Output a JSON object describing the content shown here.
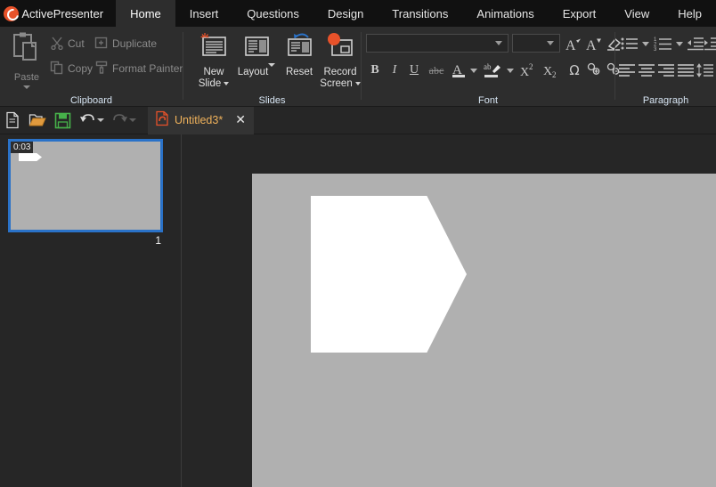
{
  "app": {
    "name": "ActivePresenter",
    "logo_icon": "activepresenter-logo-icon"
  },
  "tabs": [
    {
      "label": "Home",
      "active": true
    },
    {
      "label": "Insert",
      "active": false
    },
    {
      "label": "Questions",
      "active": false
    },
    {
      "label": "Design",
      "active": false
    },
    {
      "label": "Transitions",
      "active": false
    },
    {
      "label": "Animations",
      "active": false
    },
    {
      "label": "Export",
      "active": false
    },
    {
      "label": "View",
      "active": false
    },
    {
      "label": "Help",
      "active": false
    }
  ],
  "ribbon": {
    "clipboard": {
      "group_label": "Clipboard",
      "paste_label": "Paste",
      "paste_icon": "clipboard-icon",
      "items": [
        {
          "label": "Cut",
          "icon": "scissors-icon"
        },
        {
          "label": "Duplicate",
          "icon": "duplicate-icon"
        },
        {
          "label": "Copy",
          "icon": "copy-icon"
        },
        {
          "label": "Format Painter",
          "icon": "format-painter-icon"
        }
      ]
    },
    "slides": {
      "group_label": "Slides",
      "buttons": [
        {
          "label_line1": "New",
          "label_line2": "Slide",
          "icon": "new-slide-icon",
          "has_caret": true
        },
        {
          "label_line1": "Layout",
          "label_line2": "",
          "icon": "layout-icon",
          "has_caret": true
        },
        {
          "label_line1": "Reset",
          "label_line2": "",
          "icon": "reset-slide-icon",
          "has_caret": false
        },
        {
          "label_line1": "Record",
          "label_line2": "Screen",
          "icon": "record-screen-icon",
          "has_caret": true
        }
      ]
    },
    "font": {
      "group_label": "Font",
      "font_family_value": "",
      "font_size_value": "",
      "buttons": [
        {
          "name": "increase-font-size",
          "glyph": "A"
        },
        {
          "name": "decrease-font-size",
          "glyph": "A"
        },
        {
          "name": "clear-formatting",
          "glyph": "eraser"
        },
        {
          "name": "bold",
          "glyph": "B"
        },
        {
          "name": "italic",
          "glyph": "I"
        },
        {
          "name": "underline",
          "glyph": "U"
        },
        {
          "name": "strikethrough",
          "glyph": "abc"
        },
        {
          "name": "font-color",
          "glyph": "A"
        },
        {
          "name": "highlight-color",
          "glyph": "ab"
        },
        {
          "name": "superscript",
          "glyph": "X2"
        },
        {
          "name": "subscript",
          "glyph": "X2"
        },
        {
          "name": "symbol",
          "glyph": "Ω"
        },
        {
          "name": "increase-character-spacing",
          "glyph": "spacing+"
        },
        {
          "name": "decrease-character-spacing",
          "glyph": "spacing-"
        }
      ]
    },
    "paragraph": {
      "group_label": "Paragraph",
      "buttons": [
        {
          "name": "bullet-list"
        },
        {
          "name": "numbered-list"
        },
        {
          "name": "decrease-indent"
        },
        {
          "name": "increase-indent"
        },
        {
          "name": "align-left"
        },
        {
          "name": "align-center"
        },
        {
          "name": "align-right"
        },
        {
          "name": "justify"
        },
        {
          "name": "line-spacing"
        }
      ]
    }
  },
  "quick_access": {
    "buttons": [
      {
        "name": "new-document",
        "icon": "document-icon"
      },
      {
        "name": "open-project",
        "icon": "folder-open-icon"
      },
      {
        "name": "save-project",
        "icon": "floppy-disk-icon"
      },
      {
        "name": "undo",
        "icon": "undo-arrow-icon",
        "enabled": true
      },
      {
        "name": "redo",
        "icon": "redo-arrow-icon",
        "enabled": false
      }
    ]
  },
  "document_tab": {
    "title": "Untitled3*",
    "icon": "activepresenter-doc-icon",
    "close_glyph": "✕"
  },
  "sidebar": {
    "slides": [
      {
        "number": "1",
        "duration": "0:03",
        "selected": true
      }
    ]
  },
  "canvas": {
    "shape": {
      "name": "pentagon-arrow-shape",
      "fill": "#ffffff"
    },
    "background": "#b0b0b0"
  },
  "colors": {
    "accent": "#e8522a",
    "selection": "#2a72c8",
    "doc_tab_text": "#f0b25b",
    "ribbon_bg": "#2d2d2d",
    "titlebar_bg": "#111111",
    "panel_bg": "#262626"
  }
}
